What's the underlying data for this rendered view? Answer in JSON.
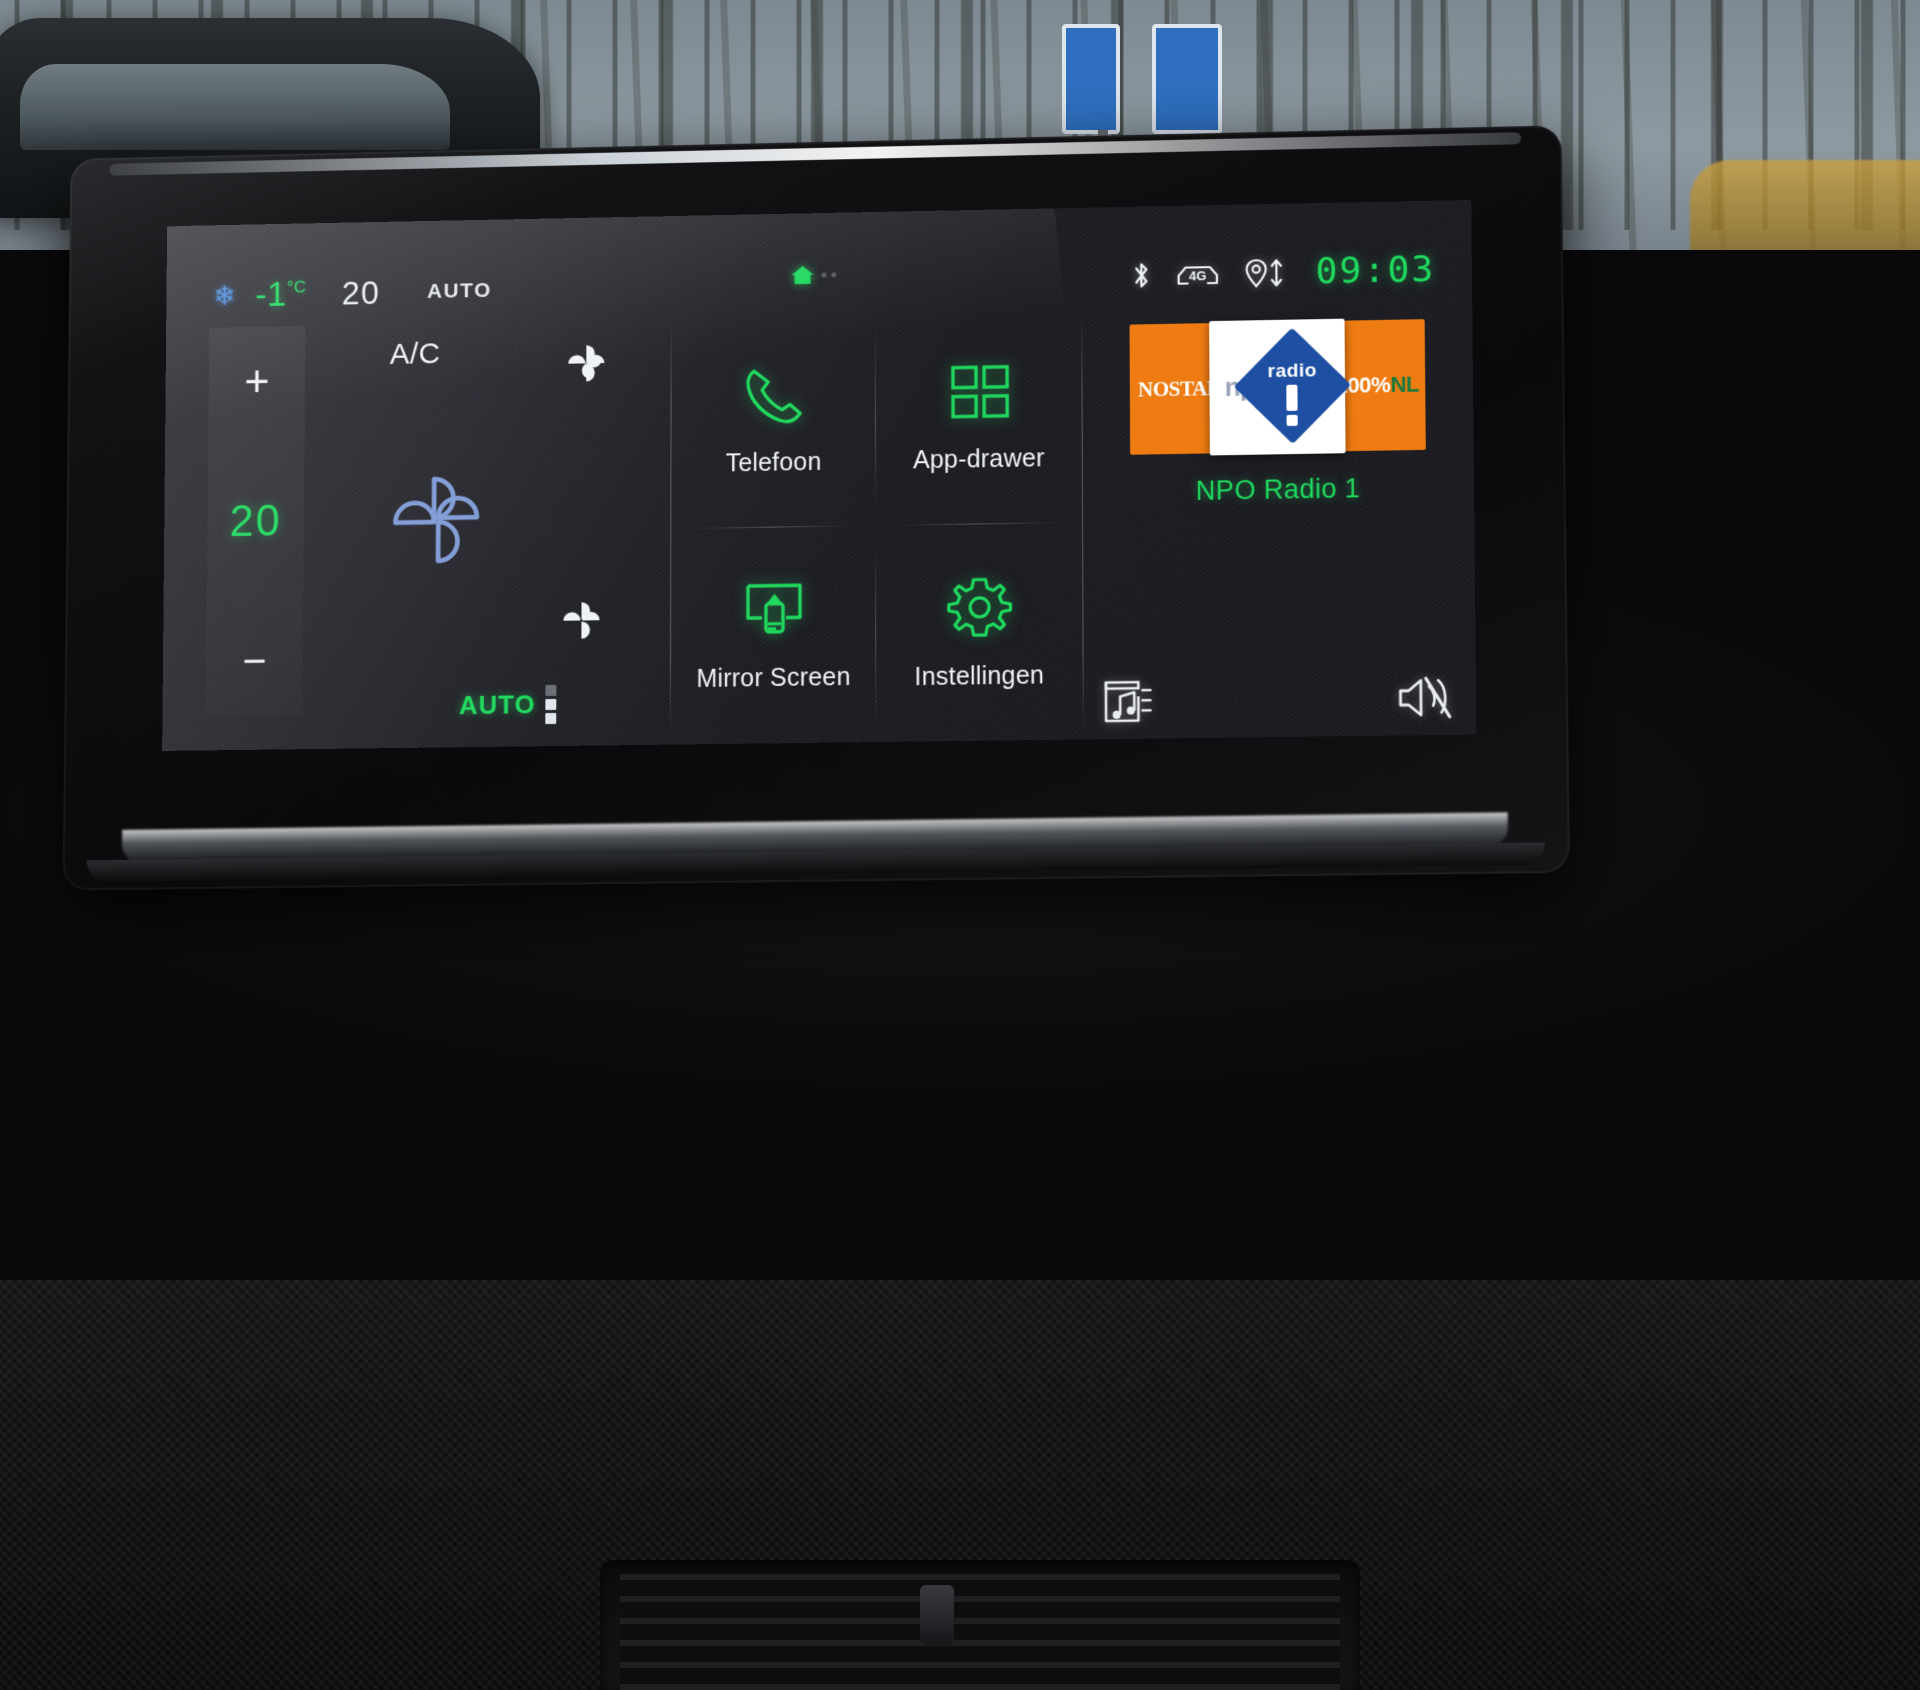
{
  "statusbar": {
    "ac_icon": "snowflake-icon",
    "outside_temp": "-1",
    "outside_temp_unit": "°C",
    "setpoint": "20",
    "auto_label": "AUTO",
    "home_icon": "home-icon",
    "bluetooth_icon": "bluetooth-icon",
    "network_icon": "4g-car-icon",
    "network_label": "4G",
    "location_icon": "location-updown-icon",
    "clock": "09:03"
  },
  "climate": {
    "plus_label": "+",
    "minus_label": "−",
    "temperature": "20",
    "ac_label": "A/C",
    "fan_top_icon": "fan-icon",
    "fan_main_icon": "fan-icon",
    "fan_bottom_icon": "fan-icon",
    "auto_fan_label": "AUTO",
    "fan_level_icon": "fan-level-indicator"
  },
  "tiles": [
    {
      "id": "telefoon",
      "label": "Telefoon",
      "icon": "phone-icon"
    },
    {
      "id": "app-drawer",
      "label": "App-drawer",
      "icon": "grid-apps-icon"
    },
    {
      "id": "mirror-screen",
      "label": "Mirror Screen",
      "icon": "screen-mirroring-icon"
    },
    {
      "id": "instellingen",
      "label": "Instellingen",
      "icon": "gear-icon"
    }
  ],
  "media": {
    "artwork_left_text": "NOSTALGIE",
    "artwork_right_text": "100%",
    "artwork_right_accent": "NL",
    "logo_word": "npo",
    "logo_radio": "radio",
    "station_name": "NPO Radio 1",
    "source_icon": "music-note-icon",
    "mute_icon": "speaker-muted-icon"
  },
  "colors": {
    "accent_green": "#1fd95e",
    "ac_blue": "#4a8fe0",
    "orange": "#ef7c12",
    "npo_blue": "#1e4fa3",
    "screen_bg": "#1d1d24"
  }
}
